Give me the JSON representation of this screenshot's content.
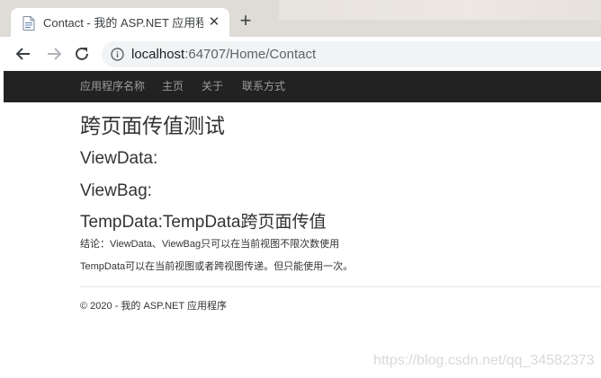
{
  "browser": {
    "tab": {
      "title": "Contact - 我的 ASP.NET 应用程",
      "close_glyph": "✕",
      "favicon": "page-icon"
    },
    "new_tab_glyph": "+",
    "address": {
      "host": "localhost",
      "path": ":64707/Home/Contact",
      "icon": "info-icon"
    },
    "nav_icons": [
      "back-arrow-icon",
      "forward-arrow-icon",
      "reload-icon"
    ]
  },
  "navbar": {
    "brand": "应用程序名称",
    "links": [
      "主页",
      "关于",
      "联系方式"
    ]
  },
  "main": {
    "heading": "跨页面传值测试",
    "viewdata": "ViewData:",
    "viewbag": "ViewBag:",
    "tempdata": "TempData:TempData跨页面传值",
    "conclusion": "结论：ViewData、ViewBag只可以在当前视图不限次数使用",
    "tempdata_note": "TempData可以在当前视图或者跨视图传递。但只能使用一次。"
  },
  "footer": {
    "text": "© 2020 - 我的 ASP.NET 应用程序"
  },
  "watermark": {
    "text": "https://blog.csdn.net/qq_34582373"
  },
  "colors": {
    "navbar_bg": "#222222",
    "navbar_link": "#9d9d9d",
    "text": "#333333",
    "tabstrip_bg": "#dfdbd6",
    "omnibox_bg": "#f1f3f4"
  }
}
